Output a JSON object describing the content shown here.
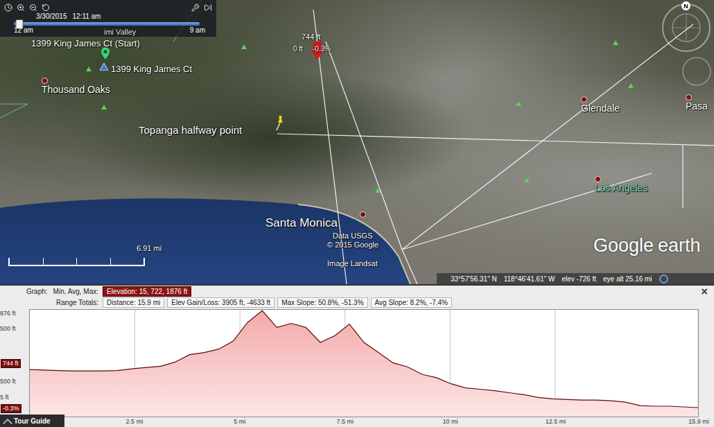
{
  "time_slider": {
    "date": "3/30/2015",
    "time": "12:11 am",
    "start": "12 am",
    "end": "9 am",
    "level": 0.03
  },
  "map": {
    "places": [
      {
        "label": "imi Valley",
        "kind": "area"
      },
      {
        "label": "Thousand Oaks",
        "kind": "city"
      },
      {
        "label": "Glendale",
        "kind": "city"
      },
      {
        "label": "Pasa",
        "kind": "city"
      },
      {
        "label": "Los Angeles",
        "kind": "major"
      },
      {
        "label": "Santa Monica",
        "kind": "large"
      }
    ],
    "start": {
      "label": "1399 King James Ct (Start)",
      "sublabel": "1399 King James Ct"
    },
    "cursor": {
      "elevation": "744 ft",
      "height": "0 ft",
      "slope": "-0.3%"
    },
    "halfway": {
      "label": "Topanga halfway point"
    },
    "attribution": [
      "Data USGS",
      "© 2015 Google",
      "Image Landsat"
    ],
    "scale": {
      "label": "6.91 mi"
    },
    "logo": {
      "brand": "Google",
      "product": "earth"
    },
    "compass": "N",
    "status": {
      "lat": "33°57'56.31\" N",
      "lon": "118°46'41.61\" W",
      "elev": "elev  -726 ft",
      "eye": "eye alt  25.16 mi"
    }
  },
  "graph": {
    "label": "Graph:",
    "stats_label": "Min, Avg, Max:",
    "elevation_stats": "Elevation: 15, 722, 1876 ft",
    "totals_label": "Range Totals:",
    "totals": [
      "Distance: 15.9 mi",
      "Elev Gain/Loss: 3905 ft, -4633 ft",
      "Max Slope: 50.8%, -51.3%",
      "Avg Slope: 8.2%, -7.4%"
    ],
    "close": "×",
    "y_ticks": [
      "876 ft",
      "500 ft",
      "500 ft",
      "5 ft"
    ],
    "x_ticks": [
      "2.5 mi",
      "5 mi",
      "7.5 mi",
      "10 mi",
      "12.5 mi",
      "15.9 mi"
    ],
    "cursor": {
      "elevation": "744 ft",
      "slope": "-0.3%"
    },
    "series": [
      {
        "name": "Elevation",
        "unit": "ft",
        "min": 15,
        "max": 1876,
        "total_distance": 15.9,
        "values": [
          744,
          735,
          725,
          718,
          718,
          718,
          725,
          757,
          783,
          809,
          887,
          1030,
          1070,
          1135,
          1291,
          1650,
          1876,
          1551,
          1630,
          1551,
          1265,
          1395,
          1616,
          1265,
          1070,
          874,
          796,
          653,
          588,
          471,
          393,
          367,
          340,
          301,
          262,
          210,
          184,
          171,
          158,
          158,
          145,
          119,
          54,
          41,
          41,
          28,
          15
        ]
      }
    ]
  },
  "tour_guide": "Tour Guide"
}
